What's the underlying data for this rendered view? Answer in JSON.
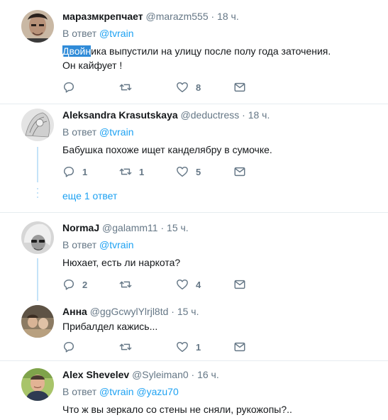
{
  "tweets": [
    {
      "name": "маразмкрепчает",
      "handle": "@marazm555",
      "time": "18 ч.",
      "reply_prefix": "В ответ",
      "reply_to": "@tvrain",
      "text_highlight": "Двойн",
      "text_rest": "ика выпустили на улицу  после полу года заточения.",
      "text_line2": "Он  кайфует !",
      "replies": "",
      "retweets": "",
      "likes": "8"
    },
    {
      "name": "Aleksandra Krasutskaya",
      "handle": "@deductress",
      "time": "18 ч.",
      "reply_prefix": "В ответ",
      "reply_to": "@tvrain",
      "text": "Бабушка похоже ищет канделябру в сумочке.",
      "replies": "1",
      "retweets": "1",
      "likes": "5",
      "more_replies": "еще 1 ответ"
    },
    {
      "name": "NormaJ",
      "handle": "@galamm11",
      "time": "15 ч.",
      "reply_prefix": "В ответ",
      "reply_to": "@tvrain",
      "text": "Нюхает, есть ли наркота?",
      "replies": "2",
      "retweets": "",
      "likes": "4"
    },
    {
      "name": "Анна",
      "handle": "@ggGcwylYlrjl8td",
      "time": "15 ч.",
      "text": "Прибалдел кажись...",
      "replies": "",
      "retweets": "",
      "likes": "1"
    },
    {
      "name": "Alex Shevelev",
      "handle": "@Syleiman0",
      "time": "16 ч.",
      "reply_prefix": "В ответ",
      "reply_to": "@tvrain",
      "reply_to_2": "@yazu70",
      "text": "Что ж вы зеркало со стены не сняли, рукожопы?.."
    }
  ],
  "separator": "·",
  "icons": [
    "reply-icon",
    "retweet-icon",
    "like-icon",
    "dm-icon"
  ],
  "colors": {
    "accent": "#1da1f2",
    "muted": "#657786",
    "thread": "#c4e3f8",
    "selection": "#2f8bd8"
  }
}
